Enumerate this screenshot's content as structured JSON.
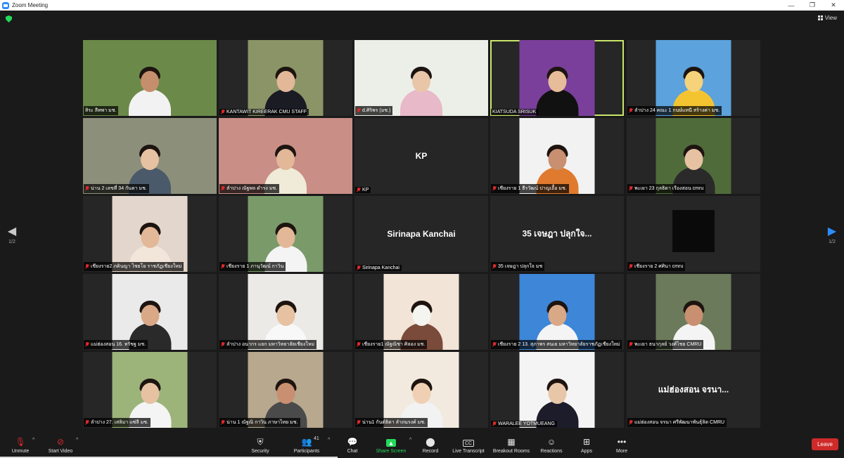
{
  "window": {
    "title": "Zoom Meeting",
    "controls": [
      "—",
      "❐",
      "✕"
    ]
  },
  "top": {
    "view_label": "View"
  },
  "paging": {
    "left": "1/2",
    "right": "1/2"
  },
  "colors": {
    "accent": "#2d8cff",
    "share_green": "#23d959",
    "leave_red": "#cf2a2a",
    "active_speaker": "#c9e76a"
  },
  "participants": [
    {
      "label": "สิระ ลีทพา มช.",
      "muted": false,
      "kind": "video",
      "bg": "#6b8a4a",
      "shirt": "#f2f2f2",
      "skin": "#c58e6c"
    },
    {
      "label": "KANTAWIT KIREERAK CMU STAFF",
      "muted": true,
      "kind": "video",
      "bg": "#8a9466",
      "shirt": "#1b1b24",
      "skin": "#e2b898"
    },
    {
      "label": "d.ศิริพร (มช.)",
      "muted": true,
      "kind": "video",
      "bg": "#ecefe8",
      "shirt": "#e8b9c8",
      "skin": "#e9c6a8"
    },
    {
      "label": "KIATSUDA SRISUK",
      "muted": false,
      "kind": "video",
      "bg": "#7a3f9a",
      "shirt": "#111111",
      "skin": "#e6bc9a",
      "active": true
    },
    {
      "label": "ลำปาง 24 คณะ 1 กนษ์แทนี สร้างค่า มช.",
      "muted": true,
      "kind": "video",
      "bg": "#5ca2dc",
      "shirt": "#f4c430",
      "skin": "#f6d27a"
    },
    {
      "label": "น่าน 2 เลขที่ 34 กันตา มช.",
      "muted": true,
      "kind": "video",
      "bg": "#8c8f7a",
      "shirt": "#4a5a6a",
      "skin": "#e6c2a2"
    },
    {
      "label": "ลำปาง ณัฐพล ดำรง มช.",
      "muted": true,
      "kind": "video",
      "bg": "#c98e86",
      "shirt": "#f0ead8",
      "skin": "#e2b898"
    },
    {
      "label": "KP",
      "muted": true,
      "kind": "name",
      "display": "KP"
    },
    {
      "label": "เชียงราย 1 ธีรวัฒน์ ปาญเอื้อ มช.",
      "muted": true,
      "kind": "video",
      "bg": "#f2f2f2",
      "shirt": "#e07a2e",
      "skin": "#c89070"
    },
    {
      "label": "พะเยา 23 กุลธิดา เรืองสอน cmru",
      "muted": true,
      "kind": "video",
      "bg": "#4f6b3a",
      "shirt": "#2a2a2a",
      "skin": "#e6c2a2"
    },
    {
      "label": "เชียงราย2 ภคินญา ไชยโย ราชภัฏเชียงใหม่",
      "muted": true,
      "kind": "video",
      "bg": "#e3d6cc",
      "shirt": "#f2e6da",
      "skin": "#e2b898"
    },
    {
      "label": "เชียงราย 1 ภานุวัฒน์ กาวิน",
      "muted": true,
      "kind": "video",
      "bg": "#7a9a6a",
      "shirt": "#f4f4f4",
      "skin": "#e2b898"
    },
    {
      "label": "Sirinapa Kanchai",
      "muted": true,
      "kind": "name",
      "display": "Sirinapa Kanchai"
    },
    {
      "label": "35 เจษฎา ปลุกใจ มช",
      "muted": true,
      "kind": "name",
      "display": "35 เจษฎา ปลุกใจ..."
    },
    {
      "label": "เชียงราย 2 ศศินา cmru",
      "muted": true,
      "kind": "black"
    },
    {
      "label": "แม่ฮ่องสอน 16. ทรัชฐ มช.",
      "muted": true,
      "kind": "video",
      "bg": "#eaeaea",
      "shirt": "#2a2a2a",
      "skin": "#d9a886"
    },
    {
      "label": "ลำปาง อนากร แยก มหาวิทยาลัยเชียงใหม่",
      "muted": true,
      "kind": "video",
      "bg": "#eceae6",
      "shirt": "#f8f8f8",
      "skin": "#e6c2a2"
    },
    {
      "label": "เชียงราย1 ณัฐณิชา ศิลอง มช.",
      "muted": true,
      "kind": "video",
      "bg": "#f2e4d6",
      "shirt": "#7a4a3a",
      "skin": "#f4f4f0"
    },
    {
      "label": "เชียงราย 2 13. สุภาพร สนเย มหาวิทยาลัยราชภัฏเชียงใหม่",
      "muted": true,
      "kind": "video",
      "bg": "#3d86d8",
      "shirt": "#f4f4f4",
      "skin": "#d9a886"
    },
    {
      "label": "พะเยา ธนากุลย์ วงศ์ไชย CMRU",
      "muted": true,
      "kind": "video",
      "bg": "#6a7a5a",
      "shirt": "#f4f4f4",
      "skin": "#c89070"
    },
    {
      "label": "ลำปาง 27. เสลิมา แซ่ลี มช.",
      "muted": true,
      "kind": "video",
      "bg": "#9cb37a",
      "shirt": "#f4f4f4",
      "skin": "#e6c2a2"
    },
    {
      "label": "น่าน 1 ณัฐณิ กาวิน ภาษาไทย มช.",
      "muted": true,
      "kind": "video",
      "bg": "#b7a88e",
      "shirt": "#4a4a4a",
      "skin": "#c89070"
    },
    {
      "label": "น่าน1 กันต์ธิดา ลำถนรงค์ มช.",
      "muted": true,
      "kind": "video",
      "bg": "#f2eadf",
      "shirt": "#f2f2f2",
      "skin": "#f0d0b4"
    },
    {
      "label": "WARALEE YOTMUEANG",
      "muted": true,
      "kind": "video",
      "bg": "#f4f4f4",
      "shirt": "#1c1c2a",
      "skin": "#e8c6a8"
    },
    {
      "label": "แม่ฮ่องสอน จรนา ศรีพัฒนาพันธุ์ลิต CMRU",
      "muted": true,
      "kind": "name",
      "display": "แม่ฮ่องสอน จรนา..."
    }
  ],
  "toolbar": {
    "unmute": "Unmute",
    "start_video": "Start Video",
    "security": "Security",
    "participants": "Participants",
    "participants_count": "41",
    "chat": "Chat",
    "share_screen": "Share Screen",
    "record": "Record",
    "live_transcript": "Live Transcript",
    "breakout_rooms": "Breakout Rooms",
    "reactions": "Reactions",
    "apps": "Apps",
    "more": "More",
    "leave": "Leave",
    "cc_badge": "CC"
  }
}
